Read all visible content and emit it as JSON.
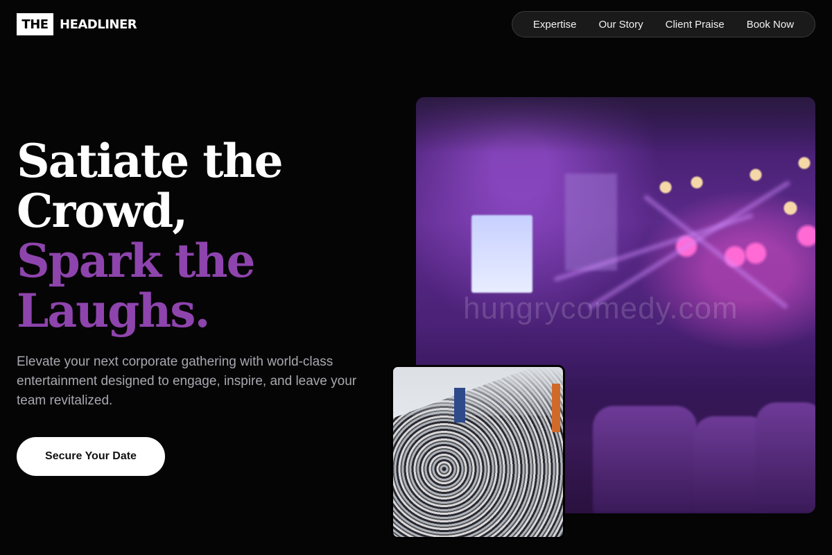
{
  "brand": {
    "box_text": "THE",
    "name": "HEADLINER"
  },
  "nav": {
    "items": [
      {
        "label": "Expertise"
      },
      {
        "label": "Our Story"
      },
      {
        "label": "Client Praise"
      },
      {
        "label": "Book Now"
      }
    ]
  },
  "hero": {
    "headline_lines": [
      "Satiate the",
      "Crowd,",
      "Spark the",
      "Laughs."
    ],
    "accent_color": "#8e44ad",
    "lede": "Elevate your next corporate gathering with world-class entertainment designed to engage, inspire, and leave your team revitalized.",
    "cta_label": "Secure Your Date"
  },
  "images": {
    "main_watermark": "hungrycomedy.com"
  }
}
